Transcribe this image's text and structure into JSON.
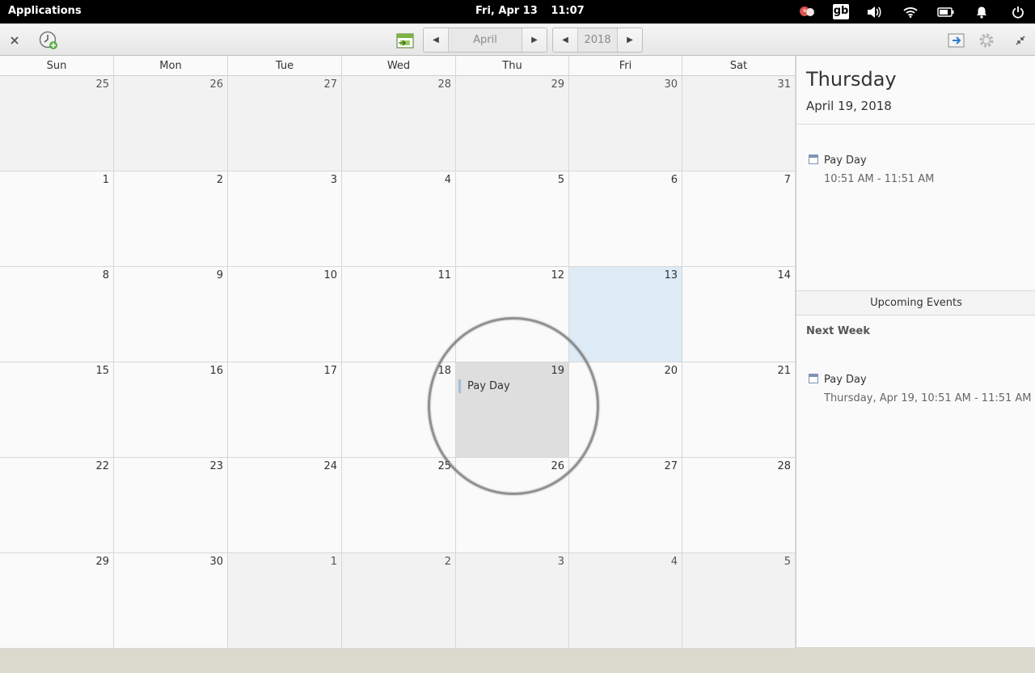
{
  "panel": {
    "applications": "Applications",
    "date": "Fri, Apr 13",
    "time": "11:07",
    "keyboard": "gb",
    "icons": [
      "notification-bubble-icon",
      "keyboard-layout-icon",
      "volume-icon",
      "wifi-icon",
      "battery-icon",
      "bell-icon",
      "power-icon"
    ]
  },
  "headerbar": {
    "month": "April",
    "year": "2018",
    "icons": [
      "close-icon",
      "add-event-clock-icon",
      "today-calendar-icon",
      "prev-icon",
      "next-icon",
      "export-icon",
      "gear-icon",
      "restore-icon"
    ]
  },
  "calendar": {
    "weekdays": [
      "Sun",
      "Mon",
      "Tue",
      "Wed",
      "Thu",
      "Fri",
      "Sat"
    ],
    "weeks": [
      [
        {
          "d": "25",
          "o": true
        },
        {
          "d": "26",
          "o": true
        },
        {
          "d": "27",
          "o": true
        },
        {
          "d": "28",
          "o": true
        },
        {
          "d": "29",
          "o": true
        },
        {
          "d": "30",
          "o": true
        },
        {
          "d": "31",
          "o": true
        }
      ],
      [
        {
          "d": "1"
        },
        {
          "d": "2"
        },
        {
          "d": "3"
        },
        {
          "d": "4"
        },
        {
          "d": "5"
        },
        {
          "d": "6"
        },
        {
          "d": "7"
        }
      ],
      [
        {
          "d": "8"
        },
        {
          "d": "9"
        },
        {
          "d": "10"
        },
        {
          "d": "11"
        },
        {
          "d": "12"
        },
        {
          "d": "13",
          "today": true
        },
        {
          "d": "14"
        }
      ],
      [
        {
          "d": "15"
        },
        {
          "d": "16"
        },
        {
          "d": "17"
        },
        {
          "d": "18"
        },
        {
          "d": "19",
          "selected": true,
          "events": [
            "Pay Day"
          ]
        },
        {
          "d": "20"
        },
        {
          "d": "21"
        }
      ],
      [
        {
          "d": "22"
        },
        {
          "d": "23"
        },
        {
          "d": "24"
        },
        {
          "d": "25"
        },
        {
          "d": "26"
        },
        {
          "d": "27"
        },
        {
          "d": "28"
        }
      ],
      [
        {
          "d": "29"
        },
        {
          "d": "30"
        },
        {
          "d": "1",
          "o": true
        },
        {
          "d": "2",
          "o": true
        },
        {
          "d": "3",
          "o": true
        },
        {
          "d": "4",
          "o": true
        },
        {
          "d": "5",
          "o": true
        }
      ]
    ]
  },
  "sidebar": {
    "day_name": "Thursday",
    "date": "April 19, 2018",
    "day_events": [
      {
        "title": "Pay Day",
        "time": "10:51 AM - 11:51 AM"
      }
    ],
    "upcoming_label": "Upcoming Events",
    "next_week_label": "Next Week",
    "upcoming": [
      {
        "title": "Pay Day",
        "time": "Thursday, Apr 19, 10:51 AM - 11:51 AM"
      }
    ]
  },
  "colors": {
    "today": "#ddebf6",
    "selected": "#dedede",
    "event_bar": "#a3bde0"
  }
}
